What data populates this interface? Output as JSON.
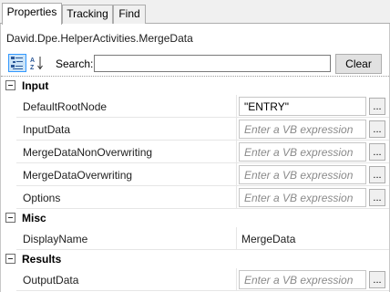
{
  "tabs": [
    {
      "label": "Properties",
      "active": true
    },
    {
      "label": "Tracking",
      "active": false
    },
    {
      "label": "Find",
      "active": false
    }
  ],
  "type_title": "David.Dpe.HelperActivities.MergeData",
  "toolbar": {
    "categorized_icon": "categorized-view-icon",
    "alphabetical_icon": "sort-az-icon",
    "search_label": "Search:",
    "search_value": "",
    "clear_label": "Clear"
  },
  "categories": [
    {
      "label": "Input",
      "properties": [
        {
          "name": "DefaultRootNode",
          "value": "\"ENTRY\""
        },
        {
          "name": "InputData",
          "placeholder": "Enter a VB expression"
        },
        {
          "name": "MergeDataNonOverwriting",
          "placeholder": "Enter a VB expression"
        },
        {
          "name": "MergeDataOverwriting",
          "placeholder": "Enter a VB expression"
        },
        {
          "name": "Options",
          "placeholder": "Enter a VB expression"
        }
      ]
    },
    {
      "label": "Misc",
      "properties": [
        {
          "name": "DisplayName",
          "value": "MergeData"
        }
      ]
    },
    {
      "label": "Results",
      "properties": [
        {
          "name": "OutputData",
          "placeholder": "Enter a VB expression"
        }
      ]
    }
  ],
  "ellipsis_label": "..."
}
